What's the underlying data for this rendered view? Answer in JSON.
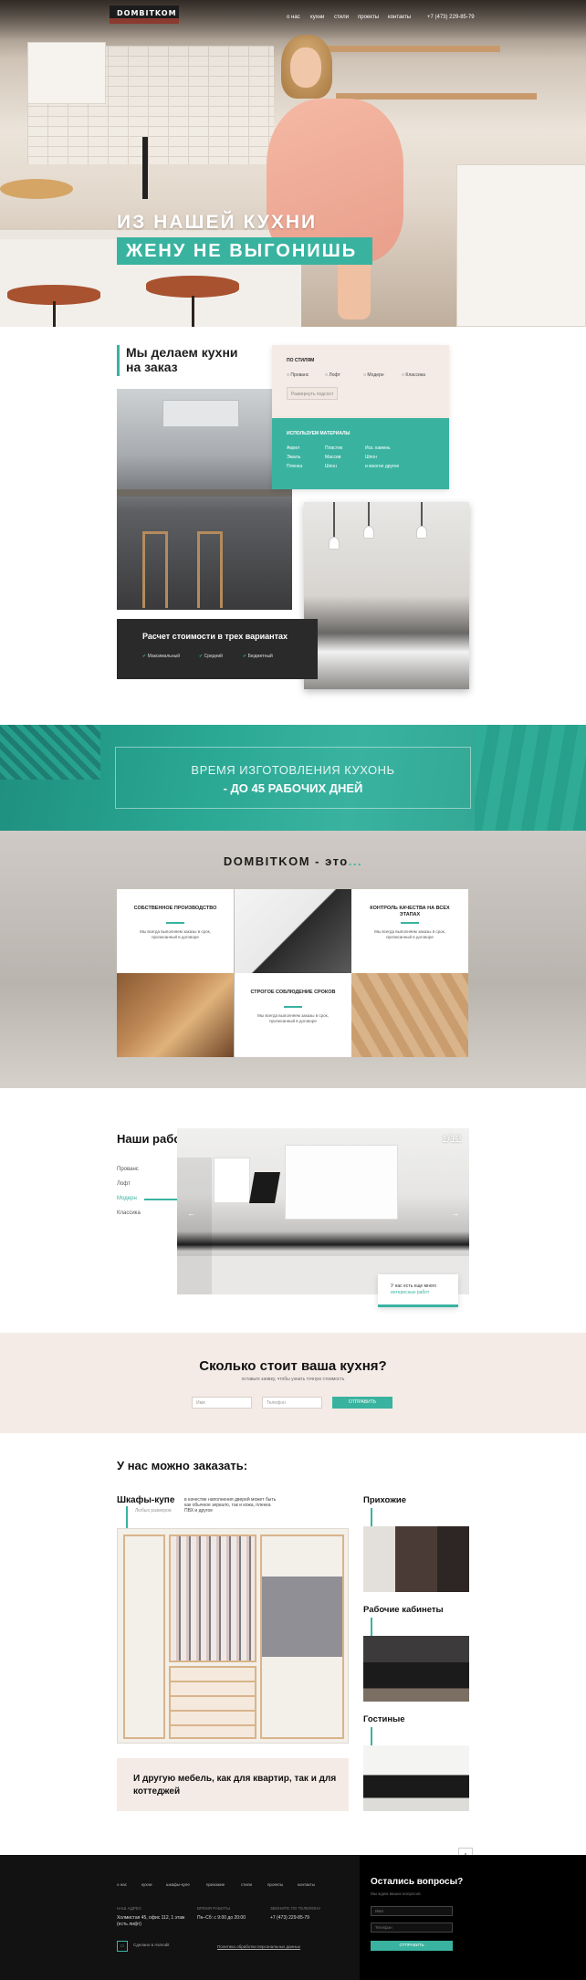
{
  "header": {
    "logo": "DOMBITKOM",
    "nav": [
      "о нас",
      "кухни",
      "стили",
      "проекты",
      "контакты"
    ],
    "phone": "+7 (473) 229-85-79"
  },
  "hero": {
    "line1": "ИЗ НАШЕЙ КУХНИ",
    "line2": "ЖЕНУ НЕ ВЫГОНИШЬ"
  },
  "section_custom": {
    "title": "Мы делаем кухни на заказ",
    "styles_heading": "ПО СТИЛЯМ",
    "styles": [
      "Прованс",
      "Лофт",
      "Модерн",
      "Классика"
    ],
    "styles_button": "Развернуть подсост",
    "materials_heading": "ИСПОЛЬЗУЕМ МАТЕРИАЛЫ",
    "materials": [
      "Акрил",
      "Пластик",
      "Иск. камень",
      "Эмаль",
      "Массив",
      "Шпон",
      "Пленка",
      "Шпон",
      "и многое другое"
    ],
    "calc_title": "Расчет стоимости в трех вариантах",
    "calc_options": [
      "Максимальный",
      "Средний",
      "Бюджетный"
    ]
  },
  "banner": {
    "line1": "ВРЕМЯ ИЗГОТОВЛЕНИЯ КУХОНЬ",
    "line2": "- ДО 45 РАБОЧИХ ДНЕЙ"
  },
  "features": {
    "title": "DOMBITKOM - это",
    "title_dots": "...",
    "items": [
      {
        "title": "СОБСТВЕННОЕ ПРОИЗВОДСТВО",
        "text": "Мы всегда выполняем заказы в срок, прописанный в договоре"
      },
      {
        "title": "КОНТРОЛЬ КАЧЕСТВА НА ВСЕХ ЭТАПАХ",
        "text": "Мы всегда выполняем заказы в срок, прописанный в договоре"
      },
      {
        "title": "СТРОГОЕ СОБЛЮДЕНИЕ СРОКОВ",
        "text": "Мы всегда выполняем заказы в срок, прописанный в договоре"
      }
    ]
  },
  "works": {
    "title": "Наши работы",
    "categories": [
      "Прованс",
      "Лофт",
      "Модерн",
      "Классика"
    ],
    "active_category": "Модерн",
    "counter": "1/12",
    "caption_line1": "У нас есть еще много",
    "caption_line2": "интересных работ"
  },
  "price": {
    "title": "Сколько стоит ваша кухня?",
    "subtitle": "оставьте заявку, чтобы узнать точную стоимость",
    "name_placeholder": "Имя",
    "phone_placeholder": "Телефон",
    "button": "ОТПРАВИТЬ"
  },
  "order": {
    "title": "У нас можно заказать:",
    "wardrobe_title": "Шкафы-купе",
    "wardrobe_sub": "Любых размеров",
    "wardrobe_text": "в качестве наполнения дверей может быть как обычное зеркало, так и кожа, пленка ПВХ и другое",
    "promo": "И другую мебель, как для квартир, так и для коттеджей",
    "side_items": [
      "Прихожие",
      "Рабочие кабинеты",
      "Гостиные"
    ]
  },
  "footer": {
    "nav": [
      "о нас",
      "кухни",
      "шкафы-купе",
      "прихожие",
      "стили",
      "проекты",
      "контакты"
    ],
    "address_label": "НАШ АДРЕС",
    "address": "Холмистая 45, офис 112, 1 этаж (есть лифт)",
    "hours_label": "ВРЕМЯ РАБОТЫ",
    "hours": "Пн–Сб: с 9:00 до 20:00",
    "phone_label": "ЗВОНИТЕ ПО ТЕЛЕФОНУ",
    "phone": "+7 (473) 229-85-79",
    "site_note": "Сделано в Asmodit",
    "policy": "Политика обработки персональных данных",
    "form_title": "Остались вопросы?",
    "form_sub": "Мы ждем ваших вопросов",
    "form_name": "Имя",
    "form_phone": "Телефон",
    "form_button": "ОТПРАВИТЬ",
    "up": "↑"
  },
  "colors": {
    "accent": "#39b3a0",
    "dark": "#121212",
    "beige": "#f5ebe6"
  }
}
